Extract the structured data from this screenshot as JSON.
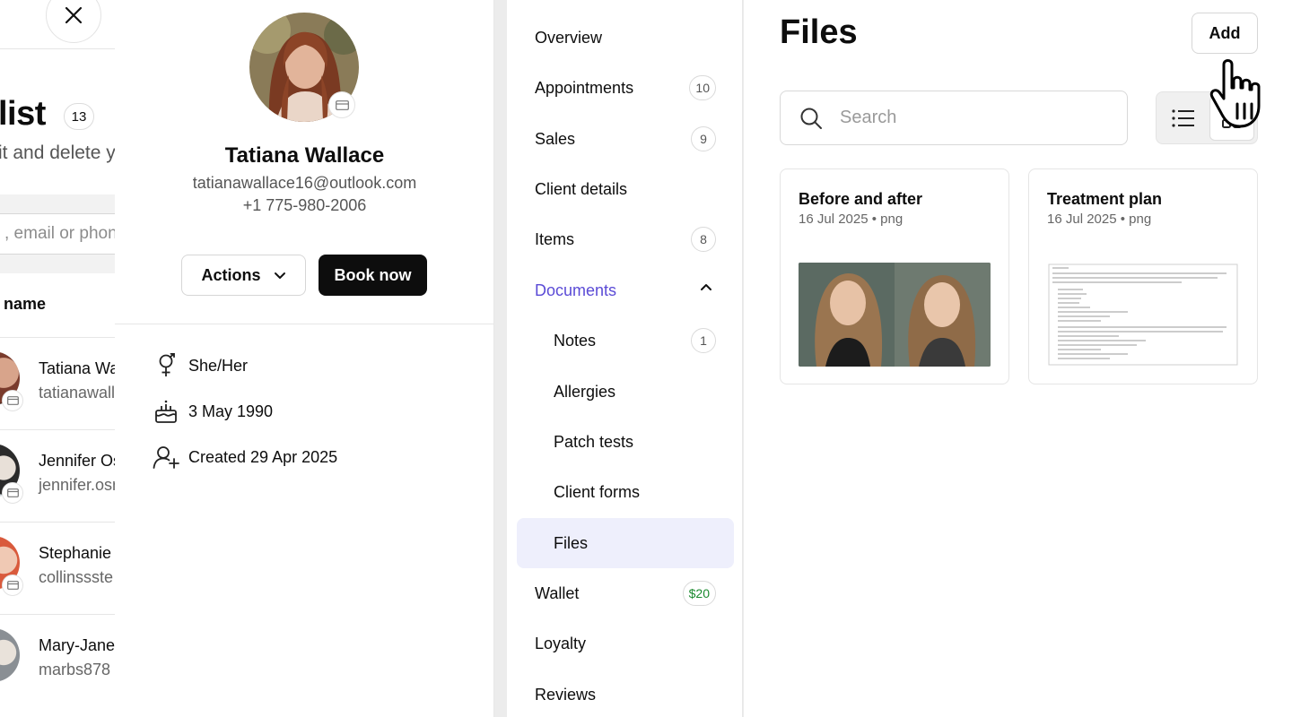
{
  "list": {
    "title": "list",
    "count": "13",
    "subtitle": "it and delete y",
    "search_placeholder": ", email or phone",
    "column_header": "name",
    "rows": [
      {
        "name": "Tatiana Wa",
        "email": "tatianawall"
      },
      {
        "name": "Jennifer Os",
        "email": "jennifer.osn"
      },
      {
        "name": "Stephanie",
        "email": "collinssste"
      },
      {
        "name": "Mary-Jane",
        "email": "marbs878"
      }
    ]
  },
  "profile": {
    "name": "Tatiana Wallace",
    "email": "tatianawallace16@outlook.com",
    "phone": "+1 775-980-2006",
    "actions_label": "Actions",
    "book_label": "Book now",
    "pronouns": "She/Her",
    "birthday": "3 May 1990",
    "created": "Created 29 Apr 2025"
  },
  "nav": {
    "items": [
      {
        "label": "Overview",
        "badge": ""
      },
      {
        "label": "Appointments",
        "badge": "10"
      },
      {
        "label": "Sales",
        "badge": "9"
      },
      {
        "label": "Client details",
        "badge": ""
      },
      {
        "label": "Items",
        "badge": "8"
      },
      {
        "label": "Documents",
        "badge": ""
      },
      {
        "label": "Notes",
        "badge": "1"
      },
      {
        "label": "Allergies",
        "badge": ""
      },
      {
        "label": "Patch tests",
        "badge": ""
      },
      {
        "label": "Client forms",
        "badge": ""
      },
      {
        "label": "Files",
        "badge": ""
      },
      {
        "label": "Wallet",
        "badge": "$20"
      },
      {
        "label": "Loyalty",
        "badge": ""
      },
      {
        "label": "Reviews",
        "badge": ""
      }
    ]
  },
  "files": {
    "title": "Files",
    "add_label": "Add",
    "search_placeholder": "Search",
    "cards": [
      {
        "title": "Before and after",
        "meta": "16 Jul 2025 • png"
      },
      {
        "title": "Treatment plan",
        "meta": "16 Jul 2025 • png"
      }
    ]
  },
  "colors": {
    "accent": "#5b4bd6",
    "active_bg": "#eeeffc",
    "primary_button": "#0d0d0d",
    "money": "#1a8a2e"
  },
  "icons": [
    "close-icon",
    "card-icon",
    "chevron-down-icon",
    "gender-icon",
    "cake-icon",
    "user-plus-icon",
    "chevron-up-icon",
    "search-icon",
    "list-view-icon",
    "grid-view-icon",
    "pointer-hand-icon"
  ]
}
